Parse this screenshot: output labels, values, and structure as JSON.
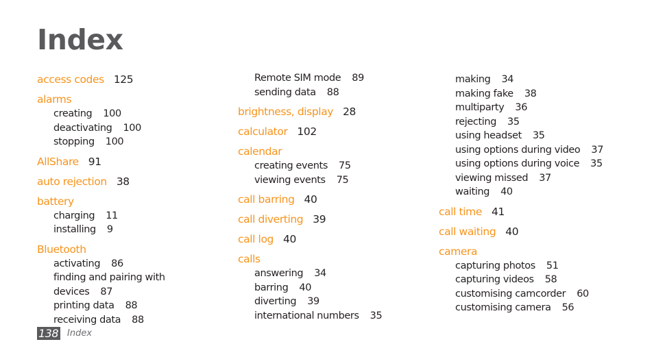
{
  "page": {
    "title": "Index",
    "footer": {
      "page_number": "138",
      "section": "Index"
    },
    "colors": {
      "term": "#f7941d",
      "title": "#5a5a5c",
      "text": "#231f20"
    }
  },
  "columns": [
    {
      "entries": [
        {
          "term": "access codes",
          "page": "125",
          "subs": []
        },
        {
          "term": "alarms",
          "page": "",
          "subs": [
            {
              "text": "creating",
              "page": "100"
            },
            {
              "text": "deactivating",
              "page": "100"
            },
            {
              "text": "stopping",
              "page": "100"
            }
          ]
        },
        {
          "term": "AllShare",
          "page": "91",
          "subs": []
        },
        {
          "term": "auto rejection",
          "page": "38",
          "subs": []
        },
        {
          "term": "battery",
          "page": "",
          "subs": [
            {
              "text": "charging",
              "page": "11"
            },
            {
              "text": "installing",
              "page": "9"
            }
          ]
        },
        {
          "term": "Bluetooth",
          "page": "",
          "subs": [
            {
              "text": "activating",
              "page": "86"
            },
            {
              "text": "finding and pairing with",
              "page": ""
            },
            {
              "text": "devices",
              "page": "87"
            },
            {
              "text": "printing data",
              "page": "88"
            },
            {
              "text": "receiving data",
              "page": "88"
            }
          ]
        }
      ]
    },
    {
      "entries": [
        {
          "term": "",
          "page": "",
          "subs": [
            {
              "text": "Remote SIM mode",
              "page": "89"
            },
            {
              "text": "sending data",
              "page": "88"
            }
          ]
        },
        {
          "term": "brightness, display",
          "page": "28",
          "subs": []
        },
        {
          "term": "calculator",
          "page": "102",
          "subs": []
        },
        {
          "term": "calendar",
          "page": "",
          "subs": [
            {
              "text": "creating events",
              "page": "75"
            },
            {
              "text": "viewing events",
              "page": "75"
            }
          ]
        },
        {
          "term": "call barring",
          "page": "40",
          "subs": []
        },
        {
          "term": "call diverting",
          "page": "39",
          "subs": []
        },
        {
          "term": "call log",
          "page": "40",
          "subs": []
        },
        {
          "term": "calls",
          "page": "",
          "subs": [
            {
              "text": "answering",
              "page": "34"
            },
            {
              "text": "barring",
              "page": "40"
            },
            {
              "text": "diverting",
              "page": "39"
            },
            {
              "text": "international numbers",
              "page": "35"
            }
          ]
        }
      ]
    },
    {
      "entries": [
        {
          "term": "",
          "page": "",
          "subs": [
            {
              "text": "making",
              "page": "34"
            },
            {
              "text": "making fake",
              "page": "38"
            },
            {
              "text": "multiparty",
              "page": "36"
            },
            {
              "text": "rejecting",
              "page": "35"
            },
            {
              "text": "using headset",
              "page": "35"
            },
            {
              "text": "using options during video",
              "page": "37"
            },
            {
              "text": "using options during voice",
              "page": "35"
            },
            {
              "text": "viewing missed",
              "page": "37"
            },
            {
              "text": "waiting",
              "page": "40"
            }
          ]
        },
        {
          "term": "call time",
          "page": "41",
          "subs": []
        },
        {
          "term": "call waiting",
          "page": "40",
          "subs": []
        },
        {
          "term": "camera",
          "page": "",
          "subs": [
            {
              "text": "capturing photos",
              "page": "51"
            },
            {
              "text": "capturing videos",
              "page": "58"
            },
            {
              "text": "customising camcorder",
              "page": "60"
            },
            {
              "text": "customising camera",
              "page": "56"
            }
          ]
        }
      ]
    }
  ]
}
